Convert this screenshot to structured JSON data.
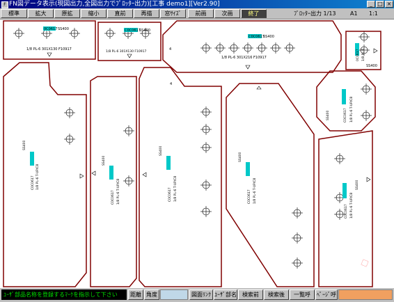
{
  "titlebar": {
    "icon": "app-icon",
    "title": "FN図データ表示(現図出力,全図出力でﾌﾟﾛｯﾀｰ出力)[工事 demo1][Ver2.90]",
    "minimize": "_",
    "maximize": "□",
    "close": "×"
  },
  "toolbar": {
    "buttons": [
      "標準",
      "拡大",
      "原拡",
      "縮小",
      "直前",
      "再描",
      "窓ｻｲｽﾞ"
    ],
    "prev_label": "前画",
    "next_label": "次画",
    "end_label": "終了",
    "plotter_output": "ﾌﾟﾛｯﾀｰ出力 1/13",
    "paper_size": "A1",
    "scale": "1:1"
  },
  "parts": {
    "p1": {
      "code": "0C0617",
      "material": "SS400",
      "spec": "1/8 PL-6 301X130 F10917"
    },
    "p2": {
      "code": "C0C0617",
      "material": "SS400",
      "spec": "1/8 PL-6 301X130 F10917"
    },
    "p3": {
      "code": "C0C0617",
      "material": "SS400",
      "spec": "1/8 PL-6 301X216 F10917"
    },
    "p4": {
      "code": "0C0617",
      "material": "SS400",
      "spec": "1/8 PL-6"
    },
    "p5": {
      "code": "C0C0617",
      "material": "SS400",
      "spec": "1/8 PL-6 T-UP/C8"
    },
    "p6": {
      "code": "C0C0617",
      "material": "SS400",
      "spec": "1/8 PL-6 T-UP/C8"
    },
    "p7": {
      "code": "C0C0617",
      "material": "SS400",
      "spec": "1/8 PL-6 T-UP/C8"
    },
    "p8": {
      "code": "C0C0617",
      "material": "SS400",
      "spec": "1/8 PL-6 T-UP/C8"
    },
    "p9": {
      "code": "C0C0617",
      "material": "SS400",
      "spec": "1/8 PL-6 T-UP/C8"
    },
    "p10": {
      "code": "C0C0617",
      "material": "SS400",
      "spec": "1/8 PL-6 T-UP/C8"
    }
  },
  "statusbar": {
    "message": "ﾕｰｻﾞ部品名称を登録するﾏｰｸを指示して下さい",
    "distance_label": "距離",
    "angle_label": "角度",
    "drawing_link": "図面ﾘﾝｸ",
    "user_part_name": "ﾕｰｻﾞ部名",
    "search_prev": "検索前",
    "search_next": "検索後",
    "list_call": "一覧呼",
    "page_call": "ﾍﾟｰｼﾞ呼",
    "page_field_color": "#f0a060"
  },
  "colors": {
    "part_outline": "#800000",
    "highlight": "#00c8c8",
    "title_start": "#000080",
    "title_end": "#1084d0",
    "status_text": "#00e000"
  }
}
